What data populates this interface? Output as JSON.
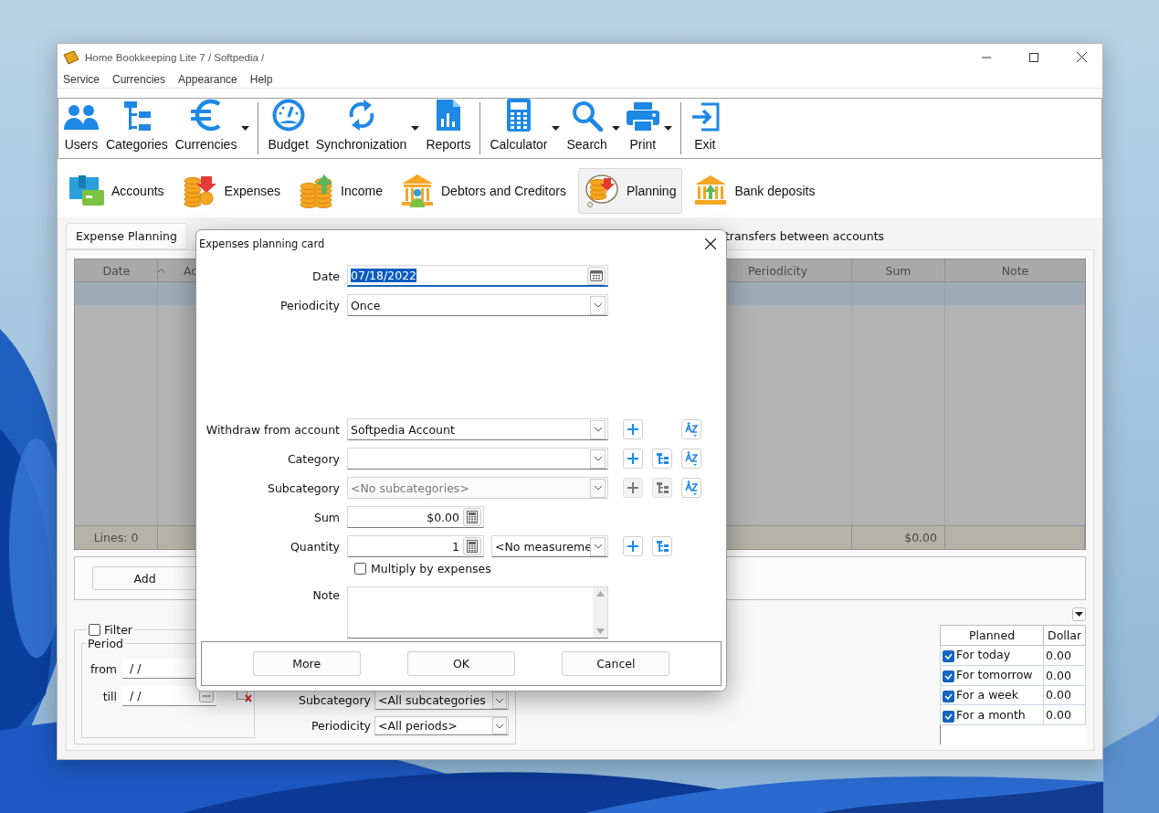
{
  "window": {
    "title": "Home Bookkeeping Lite 7  / Softpedia /"
  },
  "menu": [
    "Service",
    "Currencies",
    "Appearance",
    "Help"
  ],
  "toolbar": [
    [
      {
        "label": "Users",
        "dropdown": false
      },
      {
        "label": "Categories",
        "dropdown": false
      },
      {
        "label": "Currencies",
        "dropdown": true
      }
    ],
    [
      {
        "label": "Budget",
        "dropdown": false
      },
      {
        "label": "Synchronization",
        "dropdown": true
      },
      {
        "label": "Reports",
        "dropdown": false
      }
    ],
    [
      {
        "label": "Calculator",
        "dropdown": true
      },
      {
        "label": "Search",
        "dropdown": true
      },
      {
        "label": "Print",
        "dropdown": true
      }
    ],
    [
      {
        "label": "Exit",
        "dropdown": false
      }
    ]
  ],
  "nav_tabs": [
    {
      "label": "Accounts",
      "selected": false
    },
    {
      "label": "Expenses",
      "selected": false
    },
    {
      "label": "Income",
      "selected": false
    },
    {
      "label": "Debtors and Creditors",
      "selected": false
    },
    {
      "label": "Planning",
      "selected": true
    },
    {
      "label": "Bank deposits",
      "selected": false
    }
  ],
  "tabs": [
    {
      "label": "Expense Planning",
      "selected": true
    },
    {
      "label": "transfers between accounts",
      "selected": false
    }
  ],
  "table": {
    "columns": [
      {
        "label": "Date",
        "sorted": true
      },
      {
        "label": "Ac",
        "sorted": false
      },
      {
        "label": "Periodicity",
        "sorted": false
      },
      {
        "label": "Sum",
        "sorted": false
      },
      {
        "label": "Note",
        "sorted": false
      }
    ],
    "rows": [
      {
        "selected": true
      }
    ],
    "footer": {
      "lines": "Lines: 0",
      "sum": "$0.00"
    }
  },
  "add_button": "Add",
  "filter": {
    "label": "Filter",
    "checked": false,
    "period_label": "Period",
    "from_label": "from",
    "from_value": "/  /",
    "till_label": "till",
    "till_value": "/  /",
    "subcategory_label": "Subcategory",
    "subcategory_value": "<All subcategories",
    "periodicity_label": "Periodicity",
    "periodicity_value": "<All periods>"
  },
  "planned": {
    "columns": [
      "Planned",
      "Dollar"
    ],
    "rows": [
      {
        "label": "For today",
        "checked": true,
        "value": "0.00"
      },
      {
        "label": "For tomorrow",
        "checked": true,
        "value": "0.00"
      },
      {
        "label": "For a week",
        "checked": true,
        "value": "0.00"
      },
      {
        "label": "For a month",
        "checked": true,
        "value": "0.00"
      }
    ]
  },
  "dialog": {
    "title": "Expenses planning card",
    "date": {
      "label": "Date",
      "value": "07/18/2022",
      "text_selected": true
    },
    "periodicity": {
      "label": "Periodicity",
      "value": "Once"
    },
    "lists": [
      {
        "label": "Withdraw from account",
        "value": "Softpedia Account",
        "disabled": false,
        "actions": [
          {
            "kind": "add",
            "disabled": false
          },
          {
            "kind": "sort",
            "disabled": false
          }
        ]
      },
      {
        "label": "Category",
        "disabled": false,
        "actions": [
          {
            "kind": "add",
            "disabled": false
          },
          {
            "kind": "tree",
            "disabled": false
          },
          {
            "kind": "sort",
            "disabled": false
          }
        ]
      },
      {
        "label": "Subcategory",
        "value": "<No subcategories>",
        "disabled": true,
        "actions": [
          {
            "kind": "add",
            "disabled": true
          },
          {
            "kind": "tree",
            "disabled": true
          },
          {
            "kind": "sort",
            "disabled": false
          }
        ]
      }
    ],
    "sum": {
      "label": "Sum",
      "value": "$0.00"
    },
    "quantity": {
      "label": "Quantity",
      "value": "1",
      "unit": "<No measureme",
      "actions": [
        {
          "kind": "add",
          "disabled": false
        },
        {
          "kind": "tree",
          "disabled": false
        }
      ]
    },
    "multiply": {
      "label": "Multiply by expenses",
      "checked": false
    },
    "note": {
      "label": "Note"
    },
    "buttons": [
      "More",
      "OK",
      "Cancel"
    ]
  }
}
